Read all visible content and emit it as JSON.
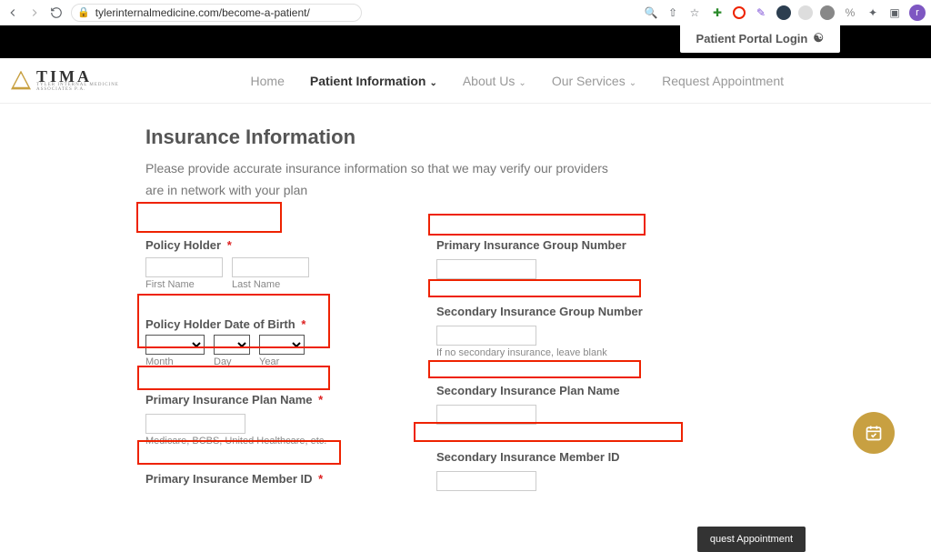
{
  "browser": {
    "url_display": "tylerinternalmedicine.com/become-a-patient/",
    "avatar_letter": "r"
  },
  "topbar": {
    "portal_login": "Patient Portal Login"
  },
  "logo": {
    "brand": "TIMA",
    "tagline1": "TYLER INTERNAL MEDICINE",
    "tagline2": "ASSOCIATES P.A."
  },
  "nav": {
    "home": "Home",
    "patient_info": "Patient Information",
    "about": "About Us",
    "services": "Our Services",
    "request": "Request Appointment"
  },
  "section": {
    "title": "Insurance Information",
    "desc": "Please provide accurate insurance information so that we may verify our providers are in network with your plan"
  },
  "left": {
    "policy_holder_label": "Policy Holder",
    "first_name_sub": "First Name",
    "last_name_sub": "Last Name",
    "dob_label": "Policy Holder Date of Birth",
    "month_sub": "Month",
    "day_sub": "Day",
    "year_sub": "Year",
    "primary_plan_label": "Primary Insurance Plan Name",
    "primary_plan_hint": "Medicare, BCBS, United Healthcare, etc.",
    "primary_member_label": "Primary Insurance Member ID"
  },
  "right": {
    "primary_group_label": "Primary Insurance Group Number",
    "secondary_group_label": "Secondary Insurance Group Number",
    "secondary_group_hint": "If no secondary insurance, leave blank",
    "secondary_plan_label": "Secondary Insurance Plan Name",
    "secondary_member_label": "Secondary Insurance Member ID"
  },
  "float": {
    "request_btn": "quest Appointment"
  }
}
